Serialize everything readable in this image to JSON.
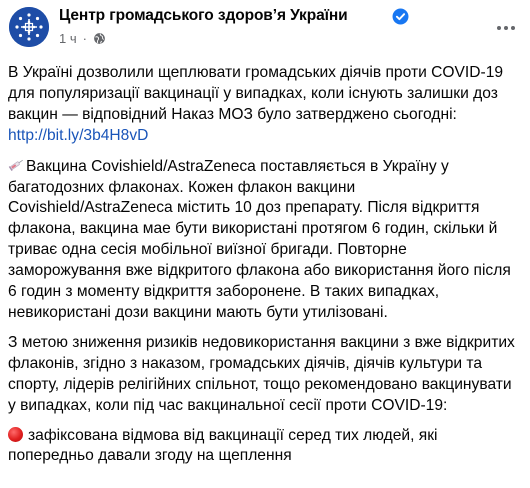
{
  "header": {
    "page_name": "Центр громадського здоров’я України",
    "time": "1 ч",
    "separator": "·",
    "icons": [
      "verified-badge-icon",
      "globe-icon",
      "more-options-icon"
    ]
  },
  "post": {
    "p1_text": "В Україні дозволили щеплювати громадських діячів проти COVID-19 для популяризації вакцинації у випадках, коли існують залишки доз вакцин — відповідний Наказ МОЗ було затверджено сьогодні: ",
    "p1_link": "http://bit.ly/3b4H8vD",
    "p2_icon": "syringe-icon",
    "p2_text": "Вакцина Covishield/AstraZeneca поставляється в Україну у багатодозних флаконах. Кожен флакон вакцини Covishield/AstraZeneca містить 10 доз препарату. Після відкриття флакона, вакцина  мае бути використані протягом 6 годин, скільки й триває одна сесія мобільної виїзної бригади. Повторне заморожування вже відкритого флакона або використання його після 6 годин з моменту відкриття заборонене. В таких випадках, невикористані дози вакцини мають бути утилізовані.",
    "p3_text": "З метою зниження ризиків недовикористання вакцини з вже відкритих флаконів, згідно з наказом, громадських діячів, діячів культури та спорту, лідерів релігійних спільнот, тощо рекомендовано вакцинувати у випадках, коли під час вакцинальної сесії проти COVID-19:",
    "p4_icon": "red-circle-icon",
    "p4_text": "зафіксована відмова від вакцинації серед тих людей, які попередньо давали згоду на щеплення"
  },
  "colors": {
    "text": "#050505",
    "muted": "#65676b",
    "link": "#1a55b9",
    "verified": "#1877f2",
    "avatar_bg": "#1e4da7"
  }
}
